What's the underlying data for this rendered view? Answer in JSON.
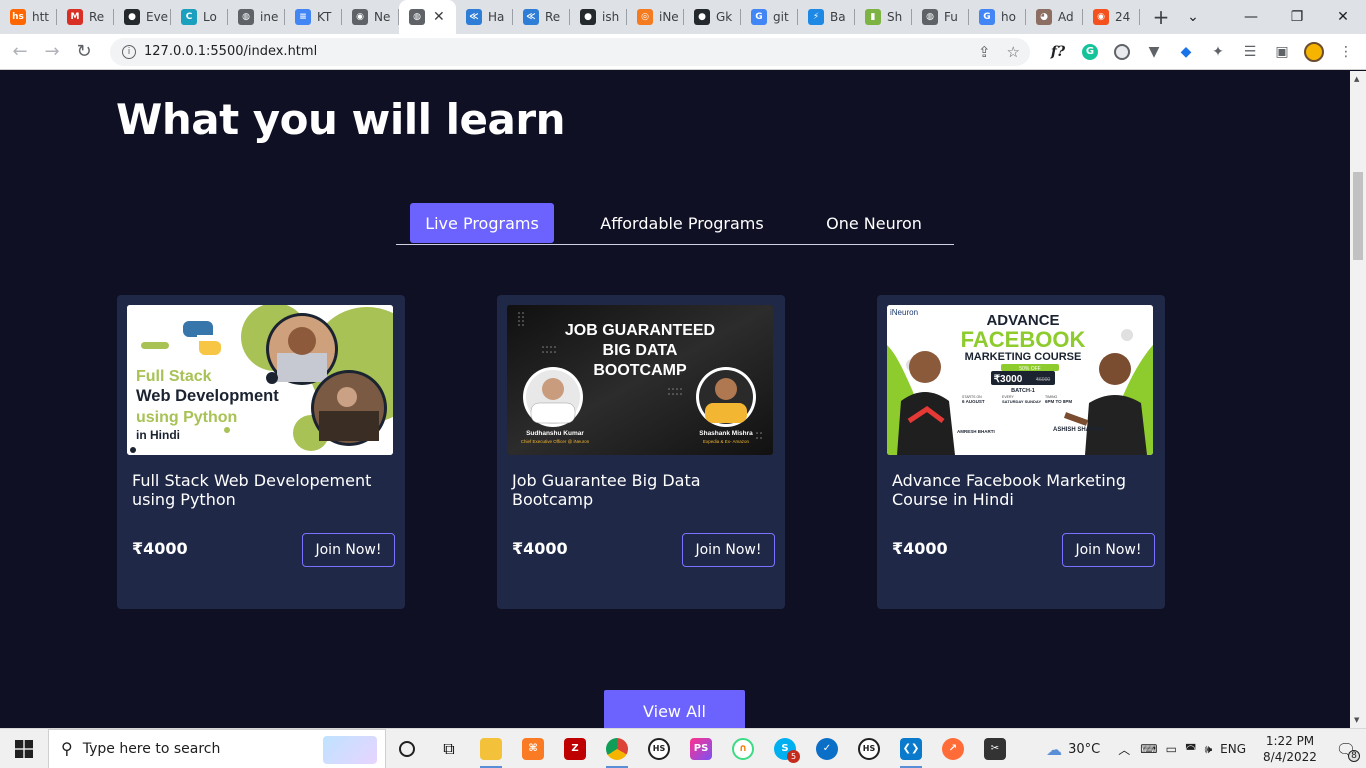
{
  "browser": {
    "tabs": [
      {
        "label": "htt",
        "icon": "hs-icon",
        "color": "#ff6600",
        "mark": "hs"
      },
      {
        "label": "Re",
        "icon": "gmail-icon",
        "color": "#d93025",
        "mark": "M"
      },
      {
        "label": "Eve",
        "icon": "github-icon",
        "color": "#24292e",
        "mark": "●"
      },
      {
        "label": "Lo",
        "icon": "codesandbox-icon",
        "color": "#1a9fbf",
        "mark": "C"
      },
      {
        "label": "ine",
        "icon": "globe-icon",
        "color": "#5f6368",
        "mark": "◍"
      },
      {
        "label": "KT",
        "icon": "google-docs-icon",
        "color": "#4285f4",
        "mark": "≡"
      },
      {
        "label": "Ne",
        "icon": "chrome-icon",
        "color": "#5f6368",
        "mark": "◉"
      },
      {
        "label": "",
        "icon": "globe-icon",
        "color": "#5f6368",
        "mark": "◍",
        "active": true
      },
      {
        "label": "Ha",
        "icon": "hackerrank-icon",
        "color": "#2e7dd7",
        "mark": "≪"
      },
      {
        "label": "Re",
        "icon": "hackerrank-icon",
        "color": "#2e7dd7",
        "mark": "≪"
      },
      {
        "label": "ish",
        "icon": "github-icon",
        "color": "#24292e",
        "mark": "●"
      },
      {
        "label": "iNe",
        "icon": "ineuron-icon",
        "color": "#f47b20",
        "mark": "◎"
      },
      {
        "label": "Gk",
        "icon": "github-icon",
        "color": "#24292e",
        "mark": "●"
      },
      {
        "label": "git",
        "icon": "google-icon",
        "color": "#4285f4",
        "mark": "G"
      },
      {
        "label": "Ba",
        "icon": "bolt-icon",
        "color": "#1e88e5",
        "mark": "⚡"
      },
      {
        "label": "Sh",
        "icon": "sheet-icon",
        "color": "#7cb342",
        "mark": "▮"
      },
      {
        "label": "Fu",
        "icon": "globe-icon",
        "color": "#5f6368",
        "mark": "◍"
      },
      {
        "label": "ho",
        "icon": "google-icon",
        "color": "#4285f4",
        "mark": "G"
      },
      {
        "label": "Ad",
        "icon": "cow-icon",
        "color": "#8d6e63",
        "mark": "◕"
      },
      {
        "label": "24",
        "icon": "orange-circle-icon",
        "color": "#f4511e",
        "mark": "◉"
      }
    ],
    "url": "127.0.0.1:5500/index.html"
  },
  "page": {
    "section_title": "What you will learn",
    "tabs": [
      "Live Programs",
      "Affordable Programs",
      "One Neuron"
    ],
    "cards": [
      {
        "title": "Full Stack Web Developement using Python",
        "price": "₹4000",
        "button": "Join Now!",
        "thumb": {
          "line1": "Full Stack",
          "line2": "Web Development",
          "line3": "using Python",
          "line4": "in Hindi"
        }
      },
      {
        "title": "Job Guarantee Big Data Bootcamp",
        "price": "₹4000",
        "button": "Join Now!",
        "thumb": {
          "line1": "JOB GUARANTEED",
          "line2": "BIG DATA",
          "line3": "BOOTCAMP",
          "person1": "Sudhanshu Kumar",
          "role1": "Chief Executive Officer @ iNeuron",
          "person2": "Shashank Mishra",
          "role2": "Expedia & Ex- Amazon"
        }
      },
      {
        "title": "Advance Facebook Marketing Course in Hindi",
        "price": "₹4000",
        "button": "Join Now!",
        "thumb": {
          "brand": "iNeuron",
          "line1": "ADVANCE",
          "line2": "FACEBOOK",
          "line3": "MARKETING COURSE",
          "discount": "50% OFF",
          "price": "₹3000",
          "old_price": "₹6000",
          "batch": "BATCH-1",
          "starts": "STARTS ON",
          "date": "6 AUGUST",
          "every": "EVERY",
          "day": "SATURDAY SUNDAY",
          "timing": "TIMING",
          "time": "6PM TO 8PM",
          "person1": "AMRESH BHARTI",
          "person2": "ASHISH SHARMA"
        }
      }
    ],
    "view_all": "View All"
  },
  "taskbar": {
    "search_placeholder": "Type here to search",
    "weather": "30°C",
    "language": "ENG",
    "time": "1:22 PM",
    "date": "8/4/2022",
    "notification_count": "8",
    "skype_badge": "5"
  }
}
